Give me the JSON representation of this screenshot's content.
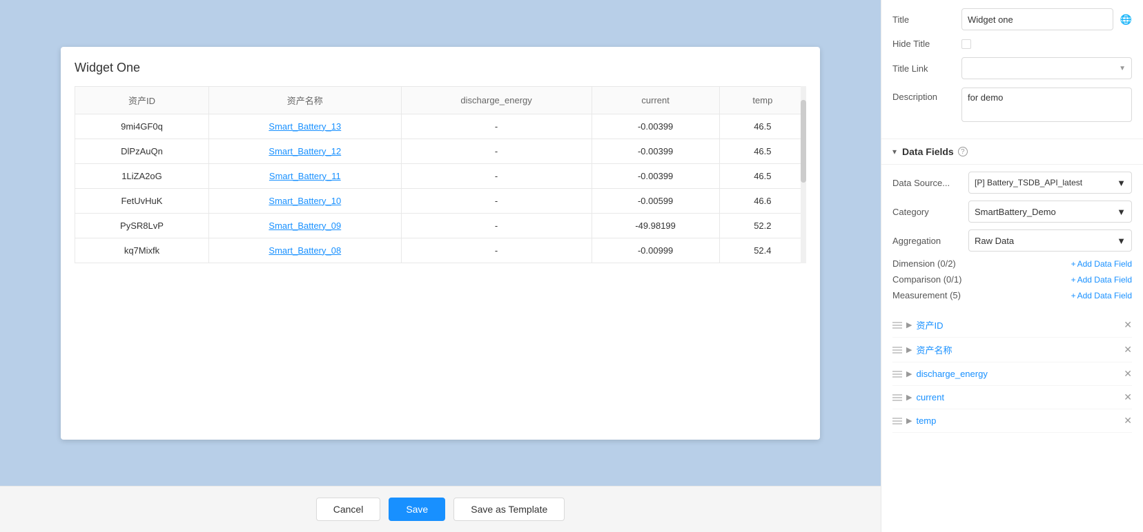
{
  "widget": {
    "title": "Widget One"
  },
  "table": {
    "columns": [
      "资产ID",
      "资产名称",
      "discharge_energy",
      "current",
      "temp"
    ],
    "rows": [
      {
        "id": "9mi4GF0q",
        "name": "Smart_Battery_13",
        "discharge_energy": "-",
        "current": "-0.00399",
        "temp": "46.5"
      },
      {
        "id": "DlPzAuQn",
        "name": "Smart_Battery_12",
        "discharge_energy": "-",
        "current": "-0.00399",
        "temp": "46.5"
      },
      {
        "id": "1LiZA2oG",
        "name": "Smart_Battery_11",
        "discharge_energy": "-",
        "current": "-0.00399",
        "temp": "46.5"
      },
      {
        "id": "FetUvHuK",
        "name": "Smart_Battery_10",
        "discharge_energy": "-",
        "current": "-0.00599",
        "temp": "46.6"
      },
      {
        "id": "PySR8LvP",
        "name": "Smart_Battery_09",
        "discharge_energy": "-",
        "current": "-49.98199",
        "temp": "52.2"
      },
      {
        "id": "kq7Mixfk",
        "name": "Smart_Battery_08",
        "discharge_energy": "-",
        "current": "-0.00999",
        "temp": "52.4"
      }
    ]
  },
  "buttons": {
    "cancel": "Cancel",
    "save": "Save",
    "save_as_template": "Save as Template"
  },
  "right_panel": {
    "title_label": "Title",
    "title_value": "Widget one",
    "hide_title_label": "Hide Title",
    "title_link_label": "Title Link",
    "description_label": "Description",
    "description_value": "for demo",
    "data_fields_title": "Data Fields",
    "data_source_label": "Data Source...",
    "data_source_value": "[P] Battery_TSDB_API_latest",
    "category_label": "Category",
    "category_value": "SmartBattery_Demo",
    "aggregation_label": "Aggregation",
    "aggregation_value": "Raw Data",
    "dimension_label": "Dimension (0/2)",
    "add_field_label": "Add Data Field",
    "comparison_label": "Comparison (0/1)",
    "measurement_label": "Measurement (5)",
    "measurement_items": [
      {
        "name": "资产ID"
      },
      {
        "name": "资产名称"
      },
      {
        "name": "discharge_energy"
      },
      {
        "name": "current"
      },
      {
        "name": "temp"
      }
    ]
  }
}
